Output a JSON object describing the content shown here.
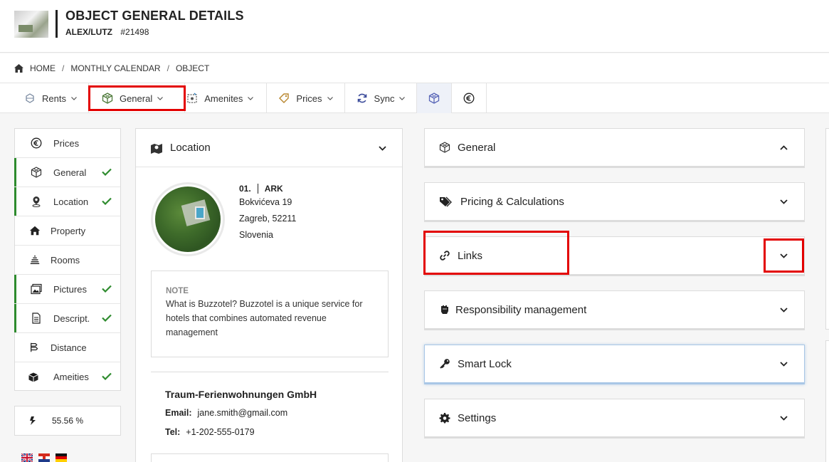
{
  "header": {
    "title": "OBJECT GENERAL DETAILS",
    "owner": "ALEX/LUTZ",
    "object_id": "#21498"
  },
  "breadcrumb": {
    "items": [
      "HOME",
      "MONTHLY CALENDAR",
      "OBJECT"
    ],
    "separator": "/"
  },
  "tabs": [
    {
      "label": "Rents",
      "icon": "rents-icon"
    },
    {
      "label": "General",
      "icon": "cube-icon"
    },
    {
      "label": "Amenites",
      "icon": "amenities-icon"
    },
    {
      "label": "Prices",
      "icon": "tag-icon"
    },
    {
      "label": "Sync",
      "icon": "sync-icon"
    }
  ],
  "sidebar": {
    "items": [
      {
        "label": "Prices",
        "icon": "euro-icon",
        "done": false
      },
      {
        "label": "General",
        "icon": "cube-icon",
        "done": true
      },
      {
        "label": "Location",
        "icon": "location-pin-icon",
        "done": true
      },
      {
        "label": "Property",
        "icon": "property-icon",
        "done": false
      },
      {
        "label": "Rooms",
        "icon": "rooms-icon",
        "done": false
      },
      {
        "label": "Pictures",
        "icon": "pictures-icon",
        "done": true
      },
      {
        "label": "Descript.",
        "icon": "document-icon",
        "done": true
      },
      {
        "label": "Distance",
        "icon": "distance-icon",
        "done": false
      },
      {
        "label": "Ameities",
        "icon": "box-icon",
        "done": true
      }
    ],
    "progress": "55.56 %"
  },
  "location": {
    "title": "Location",
    "code": "01.",
    "name": "ARK",
    "street": "Bokvićeva 19",
    "city": "Zagreb, 52211",
    "country": "Slovenia",
    "note_label": "NOTE",
    "note_text": "What is Buzzotel? Buzzotel is a unique service for hotels that combines automated revenue management",
    "company": "Traum-Ferienwohnungen GmbH",
    "email_label": "Email:",
    "email": "jane.smith@gmail.com",
    "tel_label": "Tel:",
    "tel": "+1-202-555-0179"
  },
  "accordions": [
    {
      "label": "General",
      "icon": "cube-icon",
      "expanded": true
    },
    {
      "label": "Pricing & Calculations",
      "icon": "tags-icon",
      "expanded": false
    },
    {
      "label": "Links",
      "icon": "link-icon",
      "expanded": false
    },
    {
      "label": "Responsibility management",
      "icon": "fist-icon",
      "expanded": false
    },
    {
      "label": "Smart Lock",
      "icon": "key-icon",
      "expanded": false
    },
    {
      "label": "Settings",
      "icon": "gear-icon",
      "expanded": false
    }
  ],
  "colors": {
    "check_green": "#2e8b2e",
    "highlight_red": "#e30000",
    "cube_blue": "#5a67b8"
  }
}
